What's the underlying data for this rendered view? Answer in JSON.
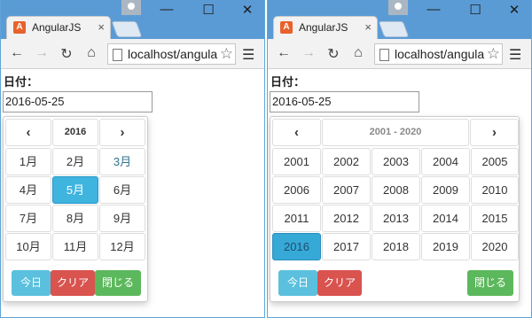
{
  "browser": {
    "tab_title": "AngularJS",
    "tab_close": "×",
    "url": "localhost/angular",
    "window_controls": [
      "—",
      "☐",
      "✕"
    ]
  },
  "form": {
    "label": "日付：",
    "value": "2016-05-25"
  },
  "month_picker": {
    "title": "2016",
    "prev": "‹",
    "next": "›",
    "months": [
      "1月",
      "2月",
      "3月",
      "4月",
      "5月",
      "6月",
      "7月",
      "8月",
      "9月",
      "10月",
      "11月",
      "12月"
    ],
    "selected": "5月",
    "current": "3月"
  },
  "year_picker": {
    "title": "2001 - 2020",
    "prev": "‹",
    "next": "›",
    "years": [
      "2001",
      "2002",
      "2003",
      "2004",
      "2005",
      "2006",
      "2007",
      "2008",
      "2009",
      "2010",
      "2011",
      "2012",
      "2013",
      "2014",
      "2015",
      "2016",
      "2017",
      "2018",
      "2019",
      "2020"
    ],
    "selected": "2016"
  },
  "buttons": {
    "today": "今日",
    "clear": "クリア",
    "close": "閉じる"
  },
  "colors": {
    "titlebar": "#5b9bd5",
    "selected": "#3fb4df",
    "today_btn": "#5bc0de",
    "clear_btn": "#d9534f",
    "close_btn": "#5cb85c"
  }
}
